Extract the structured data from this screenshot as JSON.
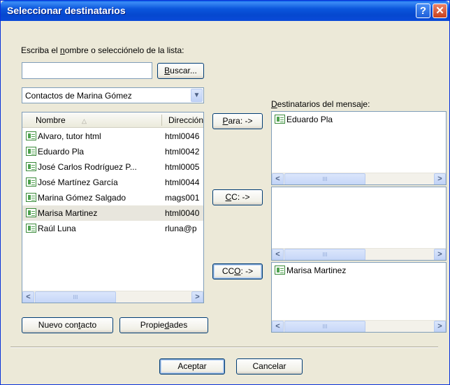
{
  "window": {
    "title": "Seleccionar destinatarios",
    "help_glyph": "?",
    "close_glyph": "✕"
  },
  "search": {
    "label_pre": "Escriba el ",
    "label_u": "n",
    "label_post": "ombre o selecciónelo de la lista:",
    "value": "",
    "button_pre": "",
    "button_u": "B",
    "button_post": "uscar..."
  },
  "addressbook": {
    "selected": "Contactos de Marina Gómez"
  },
  "contacts": {
    "headers": {
      "name": "Nombre",
      "sort_glyph": "△",
      "address": "Dirección"
    },
    "rows": [
      {
        "name": "Alvaro, tutor html",
        "address": "html0046"
      },
      {
        "name": "Eduardo Pla",
        "address": "html0042"
      },
      {
        "name": "José Carlos Rodríguez P...",
        "address": "html0005"
      },
      {
        "name": "José Martínez García",
        "address": "html0044"
      },
      {
        "name": "Marina Gómez Salgado",
        "address": "mags001"
      },
      {
        "name": "Marisa Martinez",
        "address": "html0040"
      },
      {
        "name": "Raúl Luna",
        "address": "rluna@p"
      }
    ],
    "selected_index": 5
  },
  "buttons": {
    "to": {
      "pre": "",
      "u": "P",
      "post": "ara: ->"
    },
    "cc": {
      "pre": "",
      "u": "C",
      "post": "C: ->"
    },
    "bcc": {
      "pre": "CC",
      "u": "O",
      "post": ": ->"
    },
    "new_contact": {
      "pre": "Nuevo con",
      "u": "t",
      "post": "acto"
    },
    "properties": {
      "pre": "Propie",
      "u": "d",
      "post": "ades"
    },
    "ok": "Aceptar",
    "cancel": "Cancelar"
  },
  "recipients": {
    "label_pre": "",
    "label_u": "D",
    "label_post": "estinatarios del mensaje:",
    "to": [
      "Eduardo Pla"
    ],
    "cc": [],
    "bcc": [
      "Marisa Martinez"
    ]
  },
  "scroll": {
    "left": "<",
    "right": ">",
    "thumb_grip": "III"
  },
  "icons": {
    "contact": "contact-card-icon",
    "dropdown": "chevron-down-icon"
  },
  "colors": {
    "titlebar": "#0a56dc",
    "window_bg": "#ece9d8",
    "border": "#7f9db9"
  }
}
